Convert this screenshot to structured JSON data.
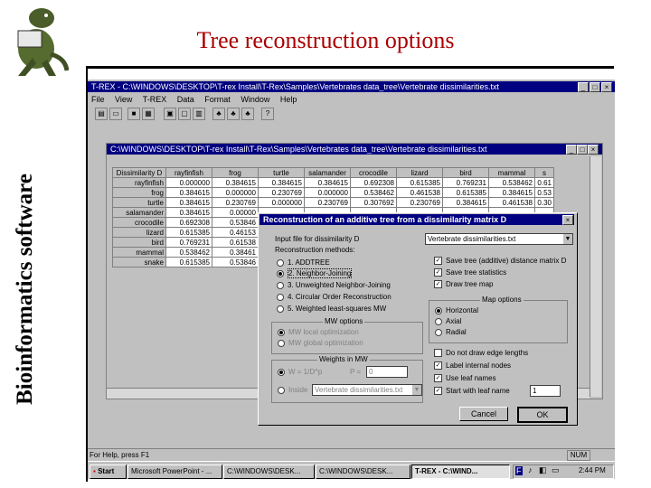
{
  "slide": {
    "title": "Tree reconstruction options",
    "side_label": "Bioinformatics software"
  },
  "app": {
    "title": "T-REX - C:\\WINDOWS\\DESKTOP\\T-rex Install\\T-Rex\\Samples\\Vertebrates data_tree\\Vertebrate dissimilarities.txt",
    "menu": [
      "File",
      "View",
      "T-REX",
      "Data",
      "Format",
      "Window",
      "Help"
    ],
    "inner_title": "C:\\WINDOWS\\DESKTOP\\T-rex Install\\T-Rex\\Samples\\Vertebrates data_tree\\Vertebrate dissimilarities.txt",
    "status_left": "For Help, press F1",
    "status_right": "NUM"
  },
  "matrix": {
    "corner": "Dissimilarity D",
    "columns": [
      "rayfinfish",
      "frog",
      "turtle",
      "salamander",
      "crocodile",
      "lizard",
      "bird",
      "mammal",
      "s"
    ],
    "rows": [
      {
        "label": "rayfinfish",
        "cells": [
          "0.000000",
          "0.384615",
          "0.384615",
          "0.384615",
          "0.692308",
          "0.615385",
          "0.769231",
          "0.538462",
          "0.61"
        ]
      },
      {
        "label": "frog",
        "cells": [
          "0.384615",
          "0.000000",
          "0.230769",
          "0.000000",
          "0.538462",
          "0.461538",
          "0.615385",
          "0.384615",
          "0.53"
        ]
      },
      {
        "label": "turtle",
        "cells": [
          "0.384615",
          "0.230769",
          "0.000000",
          "0.230769",
          "0.307692",
          "0.230769",
          "0.384615",
          "0.461538",
          "0.30"
        ]
      },
      {
        "label": "salamander",
        "cells": [
          "0.384615",
          "0.00000",
          "",
          "",
          "",
          "",
          "",
          "",
          ""
        ]
      },
      {
        "label": "crocodile",
        "cells": [
          "0.692308",
          "0.53846",
          "",
          "",
          "",
          "",
          "",
          "",
          ""
        ]
      },
      {
        "label": "lizard",
        "cells": [
          "0.615385",
          "0.46153",
          "",
          "",
          "",
          "",
          "",
          "",
          ""
        ]
      },
      {
        "label": "bird",
        "cells": [
          "0.769231",
          "0.61538",
          "",
          "",
          "",
          "",
          "",
          "",
          ""
        ]
      },
      {
        "label": "mammal",
        "cells": [
          "0.538462",
          "0.38461",
          "",
          "",
          "",
          "",
          "",
          "",
          ""
        ]
      },
      {
        "label": "snake",
        "cells": [
          "0.615385",
          "0.53846",
          "",
          "",
          "",
          "",
          "",
          "",
          ""
        ]
      }
    ]
  },
  "dialog": {
    "title": "Reconstruction of an additive tree from a dissimilarity matrix D",
    "input_label": "Input file for dissimilarity D",
    "input_value": "Vertebrate dissimilarities.txt",
    "methods_label": "Reconstruction methods:",
    "methods": [
      "1. ADDTREE",
      "2. Neighbor-Joining",
      "3. Unweighted Neighbor-Joining",
      "4. Circular Order Reconstruction",
      "5. Weighted least-squares MW"
    ],
    "mw_legend": "MW options",
    "mw_options": [
      "MW local optimization",
      "MW global optimization"
    ],
    "weights_legend": "Weights in MW",
    "weight_opt1": "W = 1/D^p",
    "p_label": "P =",
    "p_value": "0",
    "weight_opt2": "Inside",
    "weight_file": "Vertebrate dissimilarities.txt",
    "checks_top": [
      "Save tree (additive) distance matrix D",
      "Save tree statistics",
      "Draw tree map"
    ],
    "map_legend": "Map options",
    "map_options": [
      "Horizontal",
      "Axial",
      "Radial"
    ],
    "checks_bottom": [
      "Do not draw edge lengths",
      "Label internal nodes",
      "Use leaf names",
      "Start with leaf name"
    ],
    "leaf_value": "1",
    "cancel": "Cancel",
    "ok": "OK"
  },
  "taskbar": {
    "start": "Start",
    "tasks": [
      "Microsoft PowerPoint - ...",
      "C:\\WINDOWS\\DESK...",
      "C:\\WINDOWS\\DESK...",
      "T-REX - C:\\WIND..."
    ],
    "clock": "2:44 PM"
  }
}
